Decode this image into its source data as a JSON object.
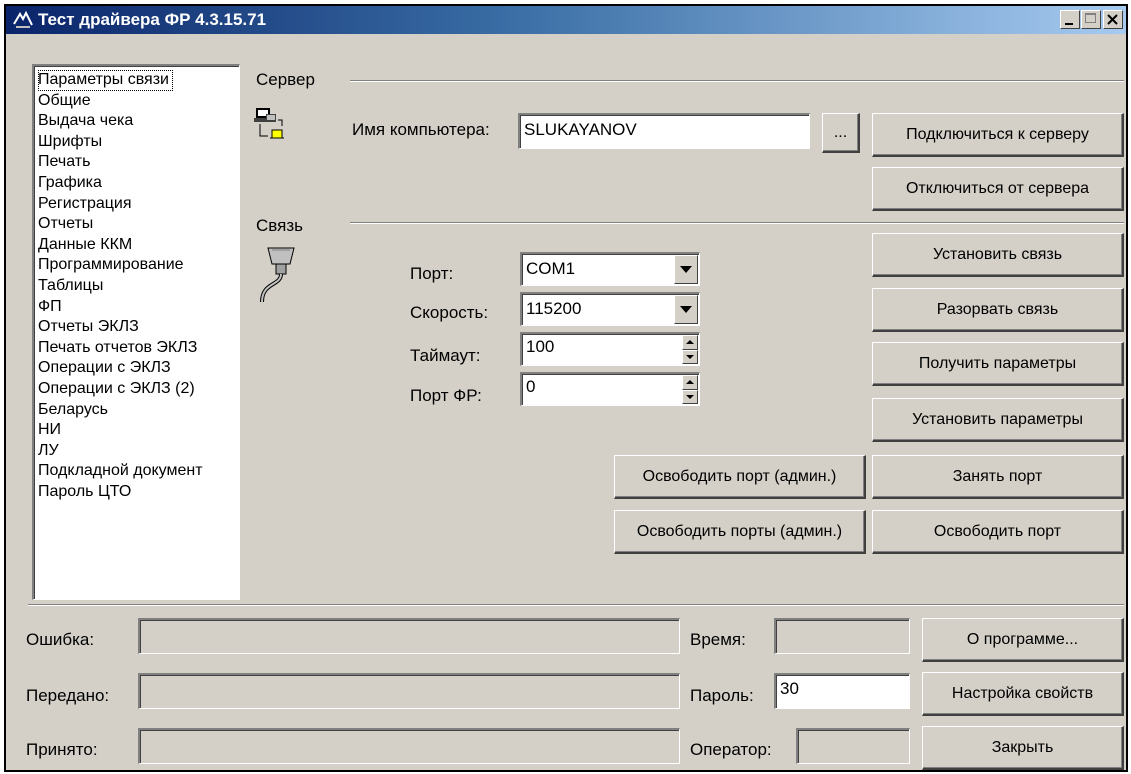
{
  "window": {
    "title": "Тест драйвера ФР 4.3.15.71"
  },
  "sidebar": {
    "items": [
      {
        "label": "Параметры связи"
      },
      {
        "label": "Общие"
      },
      {
        "label": "Выдача чека"
      },
      {
        "label": "Шрифты"
      },
      {
        "label": "Печать"
      },
      {
        "label": "Графика"
      },
      {
        "label": "Регистрация"
      },
      {
        "label": "Отчеты"
      },
      {
        "label": "Данные ККМ"
      },
      {
        "label": "Программирование"
      },
      {
        "label": "Таблицы"
      },
      {
        "label": "ФП"
      },
      {
        "label": "Отчеты ЭКЛЗ"
      },
      {
        "label": "Печать отчетов ЭКЛЗ"
      },
      {
        "label": "Операции с ЭКЛЗ"
      },
      {
        "label": "Операции с ЭКЛЗ (2)"
      },
      {
        "label": "Беларусь"
      },
      {
        "label": "НИ"
      },
      {
        "label": "ЛУ"
      },
      {
        "label": "Подкладной документ"
      },
      {
        "label": "Пароль ЦТО"
      }
    ],
    "selected_index": 0
  },
  "server": {
    "section_label": "Сервер",
    "computer_name_label": "Имя компьютера:",
    "computer_name_value": "SLUKAYANOV",
    "browse_label": "...",
    "connect_label": "Подключиться к серверу",
    "disconnect_label": "Отключиться от сервера"
  },
  "connection": {
    "section_label": "Связь",
    "port_label": "Порт:",
    "port_value": "COM1",
    "speed_label": "Скорость:",
    "speed_value": "115200",
    "timeout_label": "Таймаут:",
    "timeout_value": "100",
    "fr_port_label": "Порт ФР:",
    "fr_port_value": "0",
    "establish_label": "Установить связь",
    "break_label": "Разорвать связь",
    "get_params_label": "Получить параметры",
    "set_params_label": "Установить параметры",
    "free_port_admin_label": "Освободить порт (админ.)",
    "take_port_label": "Занять порт",
    "free_ports_admin_label": "Освободить порты (админ.)",
    "free_port_label": "Освободить порт"
  },
  "status": {
    "error_label": "Ошибка:",
    "error_value": "",
    "sent_label": "Передано:",
    "sent_value": "",
    "received_label": "Принято:",
    "received_value": "",
    "time_label": "Время:",
    "time_value": "",
    "password_label": "Пароль:",
    "password_value": "30",
    "operator_label": "Оператор:",
    "operator_value": "",
    "about_label": "О программе...",
    "settings_label": "Настройка свойств",
    "close_label": "Закрыть"
  }
}
